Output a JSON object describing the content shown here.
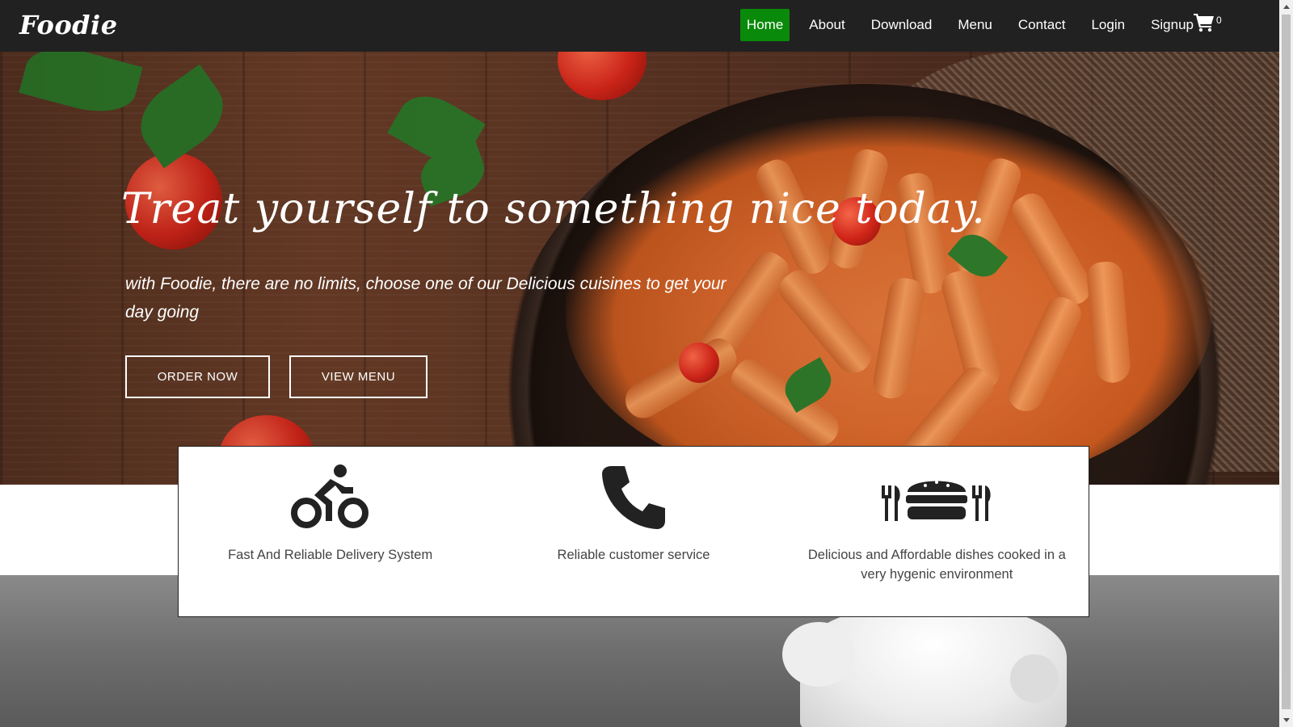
{
  "brand": {
    "logo_text": "Foodie"
  },
  "nav": {
    "items": [
      {
        "label": "Home",
        "active": true
      },
      {
        "label": "About",
        "active": false
      },
      {
        "label": "Download",
        "active": false
      },
      {
        "label": "Menu",
        "active": false
      },
      {
        "label": "Contact",
        "active": false
      },
      {
        "label": "Login",
        "active": false
      },
      {
        "label": "Signup",
        "active": false
      }
    ],
    "cart_icon": "shopping-cart-icon",
    "cart_count": "0",
    "active_color": "#0a8a0a"
  },
  "hero": {
    "title": "Treat yourself to something nice today.",
    "subtitle": "with Foodie, there are no limits, choose one of our Delicious cuisines to get your day going",
    "buttons": {
      "order": "ORDER NOW",
      "view_menu": "VIEW MENU"
    }
  },
  "features": [
    {
      "icon": "bicycle-rider-icon",
      "text": "Fast And Reliable Delivery System"
    },
    {
      "icon": "phone-icon",
      "text": "Reliable customer service"
    },
    {
      "icon": "burger-utensils-icon",
      "text": "Delicious and Affordable dishes cooked in a very hygenic environment"
    }
  ],
  "colors": {
    "navbar": "#212121",
    "accent": "#0a8a0a",
    "text_dark": "#444444"
  }
}
